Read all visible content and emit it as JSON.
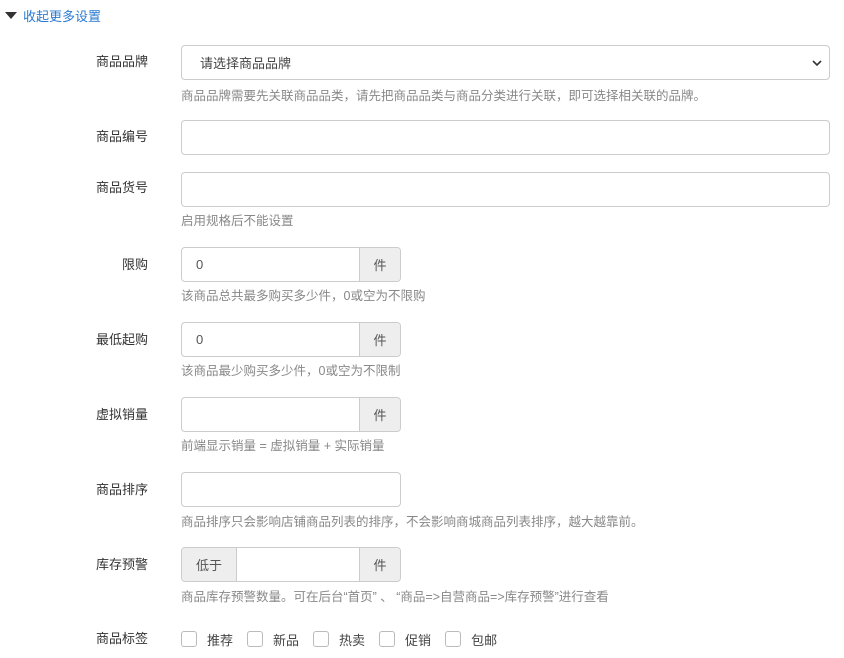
{
  "toggle_label": "收起更多设置",
  "brand": {
    "label": "商品品牌",
    "placeholder": "请选择商品品牌",
    "help": "商品品牌需要先关联商品品类，请先把商品品类与商品分类进行关联，即可选择相关联的品牌。"
  },
  "goods_sn": {
    "label": "商品编号",
    "value": ""
  },
  "goods_barcode": {
    "label": "商品货号",
    "value": "",
    "help": "启用规格后不能设置"
  },
  "limit_buy": {
    "label": "限购",
    "value": "0",
    "unit": "件",
    "help": "该商品总共最多购买多少件，0或空为不限购"
  },
  "min_buy": {
    "label": "最低起购",
    "value": "0",
    "unit": "件",
    "help": "该商品最少购买多少件，0或空为不限制"
  },
  "virtual_sales": {
    "label": "虚拟销量",
    "value": "",
    "unit": "件",
    "help": "前端显示销量 = 虚拟销量 + 实际销量"
  },
  "sort": {
    "label": "商品排序",
    "value": "",
    "help": "商品排序只会影响店铺商品列表的排序，不会影响商城商品列表排序，越大越靠前。"
  },
  "stock_warning": {
    "label": "库存预警",
    "prefix": "低于",
    "value": "",
    "unit": "件",
    "help": "商品库存预警数量。可在后台“首页” 、 “商品=>自营商品=>库存预警”进行查看"
  },
  "tags": {
    "label": "商品标签",
    "items": [
      {
        "label": "推荐",
        "checked": false
      },
      {
        "label": "新品",
        "checked": false
      },
      {
        "label": "热卖",
        "checked": false
      },
      {
        "label": "促销",
        "checked": false
      },
      {
        "label": "包邮",
        "checked": false
      }
    ]
  }
}
